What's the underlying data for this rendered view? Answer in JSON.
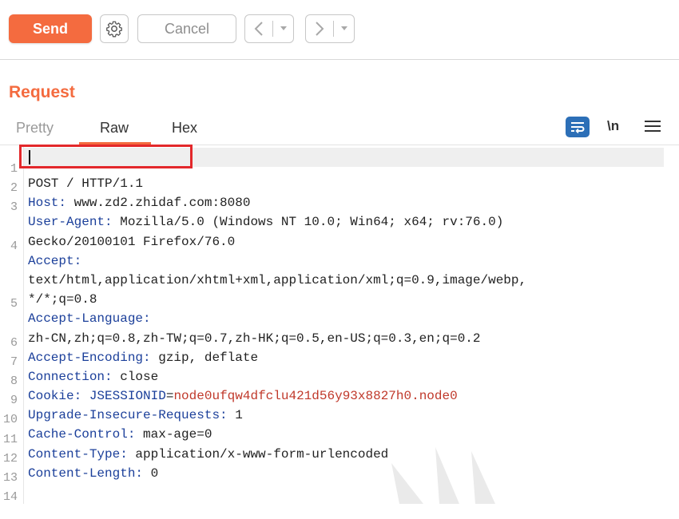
{
  "toolbar": {
    "send_label": "Send",
    "cancel_label": "Cancel",
    "back_glyph": "<",
    "forward_glyph": ">",
    "drop_glyph": "▾",
    "accent": "#f46b3f"
  },
  "panel": {
    "title": "Request",
    "tabs": [
      "Pretty",
      "Raw",
      "Hex"
    ],
    "active_tab": "Raw",
    "newline_label": "\\n"
  },
  "editor": {
    "lines": [
      {
        "n": "1",
        "name": "POST / HTTP/1.1",
        "value": ""
      },
      {
        "n": "2",
        "name": "Host:",
        "value": " www.zd2.zhidaf.com:8080"
      },
      {
        "n": "3",
        "name": "User-Agent:",
        "value": " Mozilla/5.0 (Windows NT 10.0; Win64; x64; rv:76.0)"
      },
      {
        "n": "",
        "name": "",
        "value": "Gecko/20100101 Firefox/76.0"
      },
      {
        "n": "4",
        "name": "Accept:",
        "value": ""
      },
      {
        "n": "",
        "name": "",
        "value": "text/html,application/xhtml+xml,application/xml;q=0.9,image/webp,"
      },
      {
        "n": "",
        "name": "",
        "value": "*/*;q=0.8"
      },
      {
        "n": "5",
        "name": "Accept-Language:",
        "value": ""
      },
      {
        "n": "",
        "name": "",
        "value": "zh-CN,zh;q=0.8,zh-TW;q=0.7,zh-HK;q=0.5,en-US;q=0.3,en;q=0.2"
      },
      {
        "n": "6",
        "name": "Accept-Encoding:",
        "value": " gzip, deflate"
      },
      {
        "n": "7",
        "name": "Connection:",
        "value": " close"
      },
      {
        "n": "8",
        "name": "Cookie:",
        "value": " ",
        "cookie_name": "JSESSIONID",
        "cookie_eq": "=",
        "cookie_value": "node0ufqw4dfclu421d56y93x8827h0.node0"
      },
      {
        "n": "9",
        "name": "Upgrade-Insecure-Requests:",
        "value": " 1"
      },
      {
        "n": "10",
        "name": "Cache-Control:",
        "value": " max-age=0"
      },
      {
        "n": "11",
        "name": "Content-Type:",
        "value": " application/x-www-form-urlencoded"
      },
      {
        "n": "12",
        "name": "Content-Length:",
        "value": " 0"
      },
      {
        "n": "13",
        "name": "",
        "value": ""
      },
      {
        "n": "14",
        "name": "",
        "value": ""
      }
    ],
    "header_color": "#1b3f9a",
    "cookie_color": "#c0392b",
    "highlight_color": "#e3282b"
  }
}
